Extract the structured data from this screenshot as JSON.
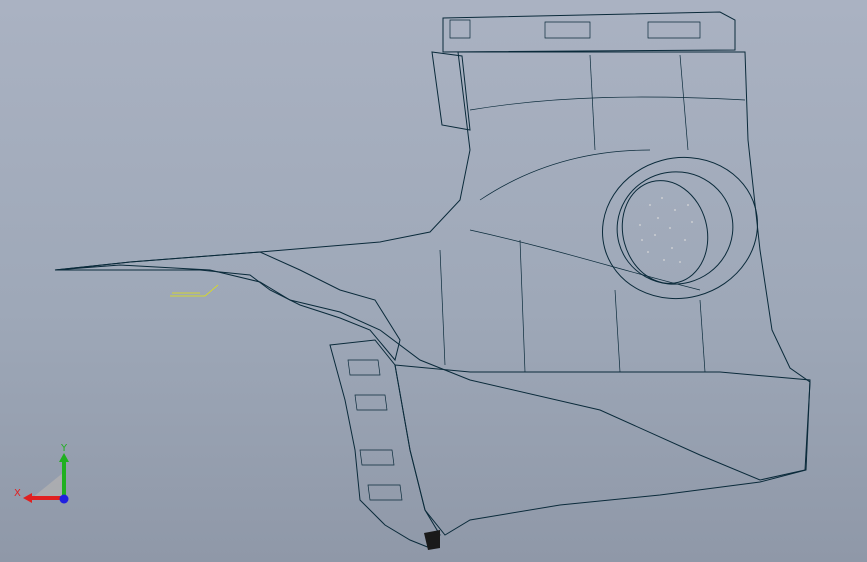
{
  "viewport": {
    "background_top": "#aab2c2",
    "background_bottom": "#8f98a8",
    "model_color": "#1ff0f5",
    "model_shade": "#17c9d6",
    "edge_color": "#0a2a3a",
    "annotation_color": "#e6e600",
    "vent_color": "#111111"
  },
  "triad": {
    "x_label": "X",
    "y_label": "Y",
    "x_color": "#e02020",
    "y_color": "#20b020",
    "z_color": "#2020e0"
  }
}
